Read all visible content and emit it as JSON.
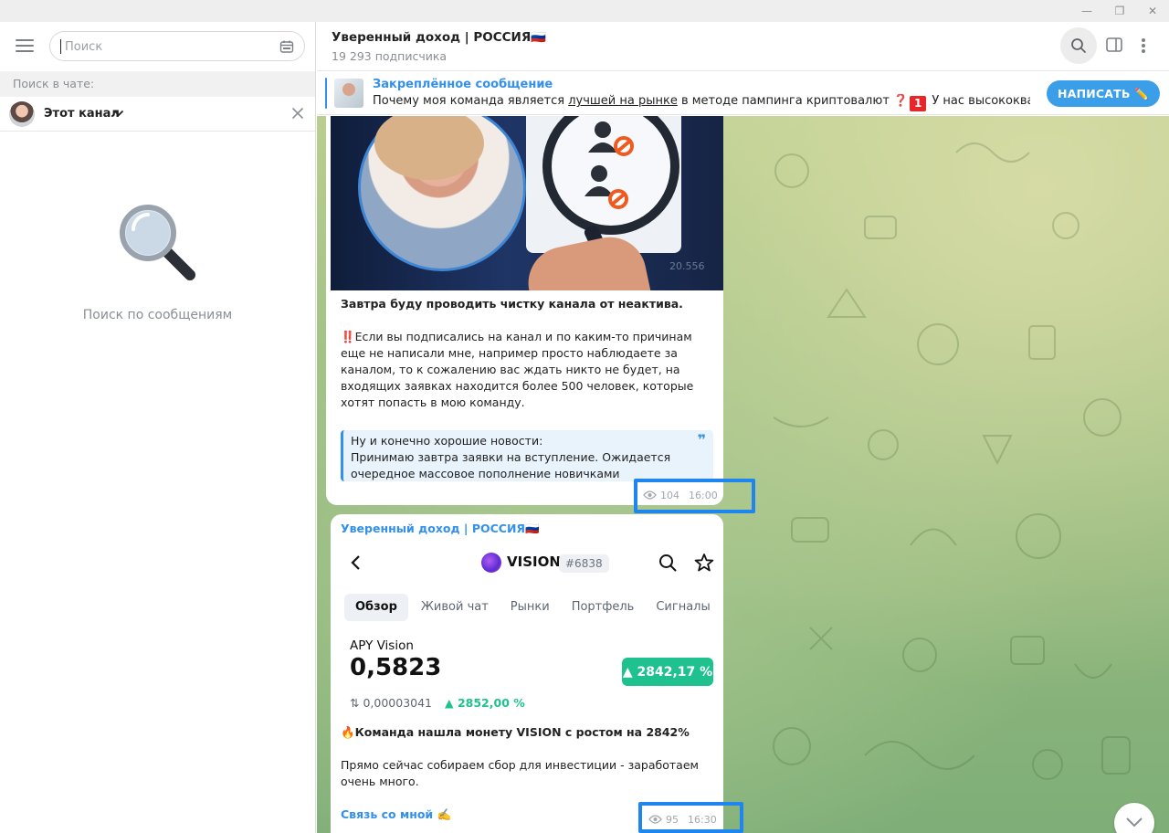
{
  "window": {
    "minimize_glyph": "—",
    "restore_glyph": "❐",
    "close_glyph": "✕"
  },
  "sidebar": {
    "search_placeholder": "Поиск",
    "search_in_chat_label": "Поиск в чате:",
    "chat_filter_label": "Этот канал",
    "empty_state_text": "Поиск по сообщениям"
  },
  "header": {
    "title": "Уверенный доход | РОССИЯ🇷🇺",
    "subtitle": "19 293 подписчика"
  },
  "pinned": {
    "title": "Закреплённое сообщение",
    "text_before": "Почему моя команда является ",
    "text_link": "лучшей на рынке",
    "text_middle": " в методе пампинга криптовалют ",
    "text_q": "❓",
    "text_one": "1",
    "text_after": " У нас высококвалифици...",
    "write_button": "НАПИСАТЬ ✏️"
  },
  "messages": [
    {
      "image_number": "20.556",
      "headline": "Завтра буду проводить чистку канала от неактива.",
      "body": "‼️Если вы подписались на канал и по каким-то причинам еще не написали мне, например просто наблюдаете за каналом, то к сожалению вас ждать никто не будет, на входящих заявках находится более 500 человек, которые хотят попасть в мою команду.",
      "quote_line1": "Ну и конечно хорошие новости:",
      "quote_line2": "Принимаю завтра заявки на вступление. Ожидается очередное массовое пополнение новичками",
      "views": "104",
      "time": "16:00"
    },
    {
      "author": "Уверенный доход | РОССИЯ🇷🇺",
      "screenshot": {
        "token_name": "VISION",
        "rank_tag": "#6838",
        "tabs": [
          "Обзор",
          "Живой чат",
          "Рынки",
          "Портфель",
          "Сигналы",
          "I"
        ],
        "pair_label": "APY Vision",
        "price": "0,5823",
        "change_chip": "▲ 2842,17 %",
        "btc_price": "0,00003041",
        "btc_change": "▲ 2852,00 %"
      },
      "headline": "🔥Команда нашла монету VISION с ростом на 2842%",
      "body": "Прямо сейчас собираем сбор для инвестиции - заработаем очень много.",
      "link": "Связь со мной ✍️",
      "views": "95",
      "time": "16:30"
    }
  ],
  "colors": {
    "accent": "#3390ec",
    "highlight_box": "#1f86f0",
    "green_chip": "#1fc28e"
  },
  "icons": [
    "menu-icon",
    "calendar-icon",
    "chevron-down-icon",
    "close-icon",
    "magnifier-emoji-icon",
    "search-icon",
    "sidebar-panel-icon",
    "more-vertical-icon",
    "eye-icon",
    "back-arrow-icon",
    "star-icon",
    "scroll-down-icon"
  ]
}
